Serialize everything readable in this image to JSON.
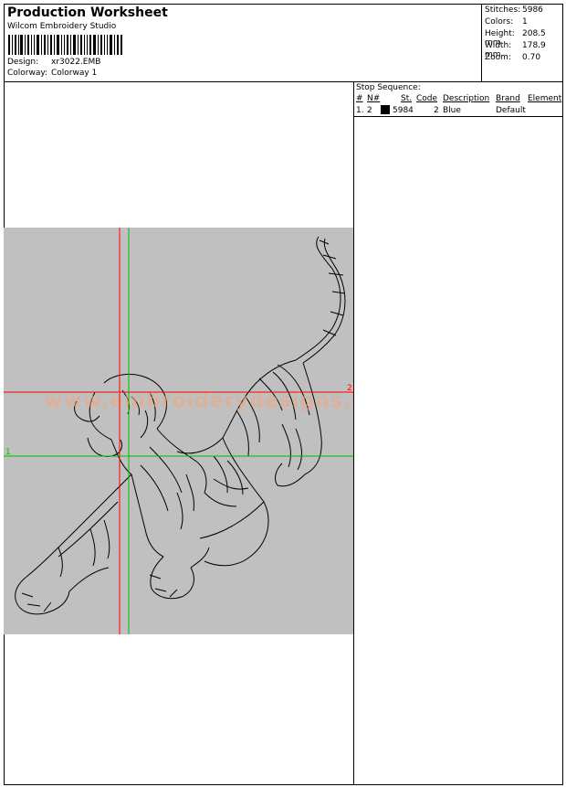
{
  "header": {
    "title": "Production Worksheet",
    "company": "Wilcom Embroidery Studio",
    "design_label": "Design:",
    "design_value": "xr3022.EMB",
    "colorway_label": "Colorway:",
    "colorway_value": "Colorway 1"
  },
  "stats": [
    {
      "label": "Stitches:",
      "value": "5986"
    },
    {
      "label": "Colors:",
      "value": "1"
    },
    {
      "label": "Height:",
      "value": "208.5 mm"
    },
    {
      "label": "Width:",
      "value": "178.9 mm"
    },
    {
      "label": "Zoom:",
      "value": "0.70"
    }
  ],
  "stop_sequence": {
    "title": "Stop Sequence:",
    "columns": [
      "#",
      "N#",
      "St.",
      "Code",
      "Description",
      "Brand",
      "Element"
    ],
    "rows": [
      {
        "num": "1.",
        "n": "2",
        "color": "#000000",
        "st": "5984",
        "code": "2",
        "description": "Blue",
        "brand": "Default",
        "element": ""
      }
    ]
  },
  "design": {
    "background": "#c0c0c0",
    "guide_red_label": "2",
    "guide_green_label": "1",
    "watermark": "www.embroiderydesigns.com"
  }
}
